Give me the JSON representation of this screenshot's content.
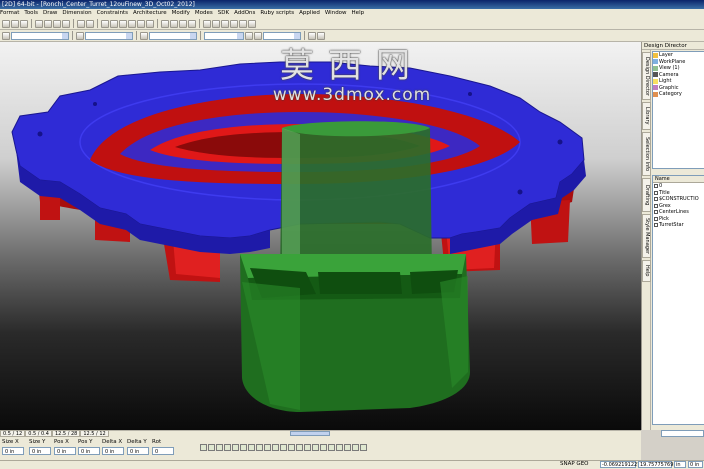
{
  "window": {
    "title": "[2D] 64-bit - [Ronchi_Center_Turret_12ouFinew_3D_Oct02_2012]"
  },
  "menu": [
    "Format",
    "Tools",
    "Draw",
    "Dimension",
    "Constraints",
    "Architecture",
    "Modify",
    "Modes",
    "SDK",
    "AddOns",
    "Ruby scripts",
    "Applied",
    "Window",
    "Help"
  ],
  "watermark": {
    "brand": "莫西网",
    "url": "www.3dmox.com"
  },
  "panel": {
    "title": "Design Director",
    "tabs": [
      "Design Director",
      "Library",
      "Selection Info",
      "Drafting",
      "Style Manager",
      "Help"
    ],
    "tree": [
      {
        "label": "Layer",
        "icon": "layer-icon"
      },
      {
        "label": "WorkPlane",
        "icon": "workplane-icon"
      },
      {
        "label": "View (1)",
        "icon": "view-icon"
      },
      {
        "label": "Camera",
        "icon": "camera-icon"
      },
      {
        "label": "Light",
        "icon": "light-icon"
      },
      {
        "label": "Graphic",
        "icon": "graphic-icon"
      },
      {
        "label": "Category",
        "icon": "category-icon"
      }
    ],
    "list_header": "Name",
    "layers": [
      "0",
      "Title",
      "$CONSTRUCTIO",
      "Grex",
      "CenterLines",
      "Pick",
      "TurretStar"
    ]
  },
  "sheets": [
    "0.5 / 12",
    "0.5 / 0.4",
    "12.5 / 28",
    "12.5 / 12"
  ],
  "status_columns": [
    {
      "label": "Size X",
      "value": "0 in"
    },
    {
      "label": "Size Y",
      "value": "0 in"
    },
    {
      "label": "Pos X",
      "value": "0 in"
    },
    {
      "label": "Pos Y",
      "value": "0 in"
    },
    {
      "label": "Delta X",
      "value": "0 in"
    },
    {
      "label": "Delta Y",
      "value": "0 in"
    },
    {
      "label": "Rot",
      "value": "0"
    }
  ],
  "statusbar": {
    "snap": "SNAP  GEO",
    "coord_x": "-0.0692191227",
    "coord_y": "19.75775769",
    "unit": "in",
    "page": "0 in"
  },
  "colors": {
    "ring_blue": "#3a35e0",
    "ring_red": "#d21010",
    "cup_green": "#1f7a1f"
  }
}
